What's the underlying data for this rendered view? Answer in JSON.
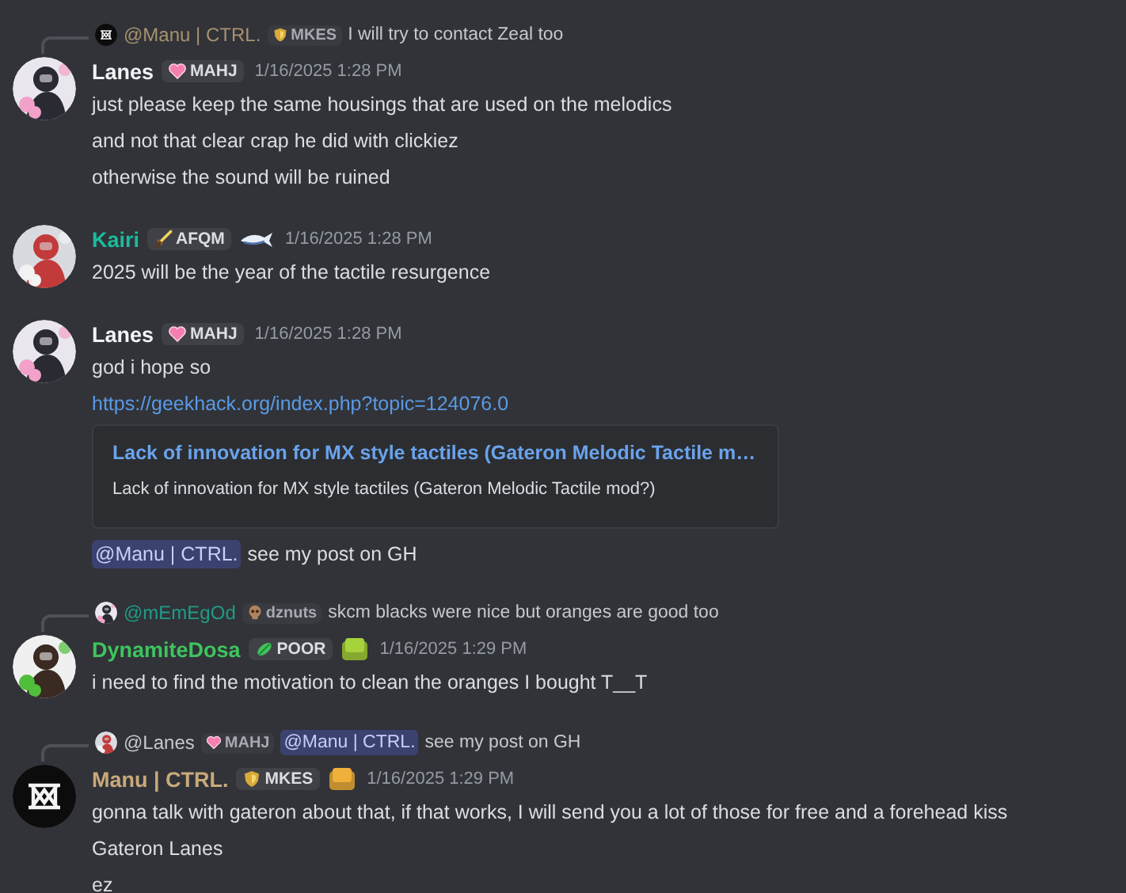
{
  "messages": [
    {
      "reply": {
        "avatar": {
          "kind": "logo"
        },
        "author": "@Manu | CTRL.",
        "color": "#a8916f",
        "tag": {
          "kind": "shield",
          "label": "MKES"
        },
        "text": "I will try to contact Zeal too"
      },
      "avatar": {
        "kind": "picture"
      },
      "author": "Lanes",
      "color": "#f2f3f5",
      "tag": {
        "kind": "heart",
        "label": "MAHJ"
      },
      "timestamp": "1/16/2025 1:28 PM",
      "lines": [
        {
          "kind": "text",
          "text": "just please keep the same housings that are used on the melodics"
        },
        {
          "kind": "text",
          "text": "and not that clear crap he did with clickiez"
        },
        {
          "kind": "text",
          "text": "otherwise the sound will be ruined"
        }
      ]
    },
    {
      "avatar": {
        "kind": "picture"
      },
      "author": "Kairi",
      "color": "#1abc9c",
      "tag": {
        "kind": "sword",
        "label": "AFQM"
      },
      "extra": {
        "kind": "whale"
      },
      "timestamp": "1/16/2025 1:28 PM",
      "lines": [
        {
          "kind": "text",
          "text": "2025 will be the year of the tactile resurgence"
        }
      ]
    },
    {
      "avatar": {
        "kind": "picture"
      },
      "author": "Lanes",
      "color": "#f2f3f5",
      "tag": {
        "kind": "heart",
        "label": "MAHJ"
      },
      "timestamp": "1/16/2025 1:28 PM",
      "lines": [
        {
          "kind": "text",
          "text": "god i hope so"
        },
        {
          "kind": "link",
          "text": "https://geekhack.org/index.php?topic=124076.0"
        },
        {
          "kind": "embed",
          "title": "Lack of innovation for MX style tactiles (Gateron Melodic Tactile m…",
          "description": "Lack of innovation for MX style tactiles (Gateron Melodic Tactile mod?)"
        },
        {
          "kind": "mention",
          "mention": "@Manu | CTRL.",
          "text": "see my post on GH"
        }
      ]
    },
    {
      "reply": {
        "avatar": {
          "kind": "picture"
        },
        "author": "@mEmEgOd",
        "color": "#1f9c86",
        "tag": {
          "kind": "skull",
          "label": "dznuts"
        },
        "text": "skcm blacks were nice but oranges are good too"
      },
      "avatar": {
        "kind": "picture"
      },
      "author": "DynamiteDosa",
      "color": "#3ec45e",
      "tag": {
        "kind": "leaf",
        "label": "POOR"
      },
      "extra": {
        "kind": "keycap",
        "color": "#a6d23a"
      },
      "timestamp": "1/16/2025 1:29 PM",
      "lines": [
        {
          "kind": "text",
          "text": "i need to find the motivation to clean the oranges I bought T__T"
        }
      ]
    },
    {
      "reply": {
        "avatar": {
          "kind": "picture"
        },
        "author": "@Lanes",
        "color": "#c4c9ce",
        "tag": {
          "kind": "heart",
          "label": "MAHJ"
        },
        "mention": "@Manu | CTRL.",
        "text": "see my post on GH"
      },
      "avatar": {
        "kind": "logo"
      },
      "author": "Manu | CTRL.",
      "color": "#c9a97a",
      "tag": {
        "kind": "shield",
        "label": "MKES"
      },
      "extra": {
        "kind": "keycap",
        "color": "#f0b03c"
      },
      "timestamp": "1/16/2025 1:29 PM",
      "lines": [
        {
          "kind": "text",
          "text": "gonna talk with gateron about that, if that works, I will send you a lot of those for free and a forehead kiss"
        },
        {
          "kind": "text",
          "text": "Gateron Lanes"
        },
        {
          "kind": "text",
          "text": "ez"
        }
      ]
    }
  ]
}
